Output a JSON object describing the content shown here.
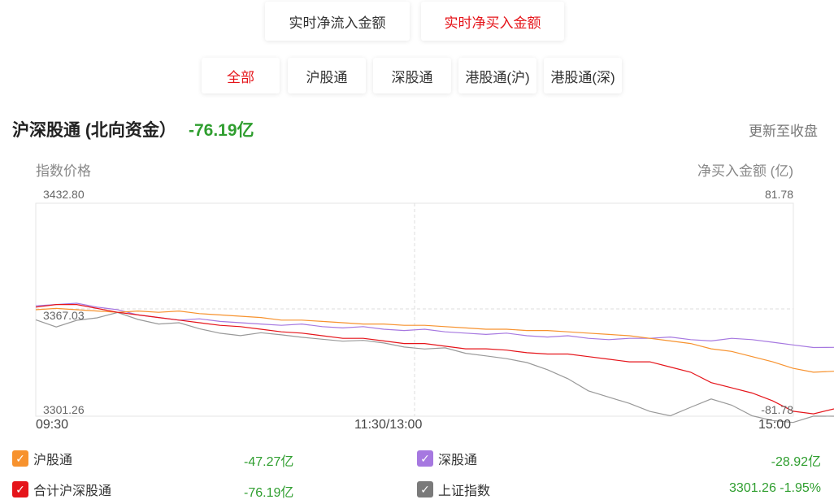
{
  "top_tabs": [
    {
      "label": "实时净流入金额",
      "active": false
    },
    {
      "label": "实时净买入金额",
      "active": true
    }
  ],
  "market_tabs": [
    {
      "label": "全部",
      "active": true
    },
    {
      "label": "沪股通",
      "active": false
    },
    {
      "label": "深股通",
      "active": false
    },
    {
      "label": "港股通(沪)",
      "active": false
    },
    {
      "label": "港股通(深)",
      "active": false
    }
  ],
  "header": {
    "title": "沪深股通 (北向资金）",
    "value": "-76.19亿",
    "update_link": "更新至收盘"
  },
  "chart_data": {
    "type": "line",
    "left_axis_title": "指数价格",
    "right_axis_title": "净买入金额 (亿)",
    "left_ticks": [
      "3432.80",
      "3367.03",
      "3301.26"
    ],
    "right_ticks": [
      "81.78",
      "-81.78"
    ],
    "x_ticks": [
      "09:30",
      "11:30/13:00",
      "15:00"
    ],
    "left_ylim": [
      3301.26,
      3432.8
    ],
    "right_ylim": [
      -81.78,
      81.78
    ],
    "grid": true,
    "series": [
      {
        "name": "沪股通",
        "color": "#f7922e",
        "axis": "right",
        "values": [
          0,
          1,
          0,
          -1,
          -2,
          -1,
          -2,
          -1,
          -3,
          -4,
          -5,
          -6,
          -8,
          -8,
          -9,
          -10,
          -11,
          -11,
          -12,
          -12,
          -13,
          -14,
          -15,
          -15,
          -16,
          -16,
          -17,
          -18,
          -19,
          -20,
          -22,
          -24,
          -26,
          -30,
          -32,
          -36,
          -40,
          -45,
          -48,
          -47.27
        ]
      },
      {
        "name": "深股通",
        "color": "#a678e0",
        "axis": "right",
        "values": [
          3,
          4,
          5,
          2,
          0,
          -4,
          -6,
          -8,
          -7,
          -9,
          -10,
          -11,
          -12,
          -11,
          -13,
          -14,
          -13,
          -15,
          -16,
          -15,
          -17,
          -18,
          -19,
          -18,
          -20,
          -21,
          -20,
          -22,
          -23,
          -22,
          -22,
          -21,
          -23,
          -24,
          -22,
          -23,
          -25,
          -27,
          -29,
          -28.92
        ]
      },
      {
        "name": "合计沪深股通",
        "color": "#e5141a",
        "axis": "right",
        "values": [
          2,
          4,
          4,
          1,
          -2,
          -4,
          -6,
          -8,
          -10,
          -12,
          -13,
          -15,
          -17,
          -18,
          -20,
          -22,
          -22,
          -24,
          -26,
          -26,
          -28,
          -30,
          -30,
          -31,
          -33,
          -34,
          -34,
          -36,
          -38,
          -40,
          -40,
          -44,
          -48,
          -56,
          -60,
          -64,
          -70,
          -78,
          -80,
          -76.19
        ]
      },
      {
        "name": "上证指数",
        "color": "#999999",
        "axis": "left",
        "values": [
          3360.8,
          3356.4,
          3360.5,
          3362.0,
          3365.3,
          3361.0,
          3358.2,
          3359.0,
          3355.3,
          3352.5,
          3351.0,
          3352.8,
          3351.5,
          3350.0,
          3348.8,
          3347.6,
          3348.1,
          3346.5,
          3344.0,
          3342.8,
          3343.5,
          3340.1,
          3338.5,
          3336.8,
          3334.4,
          3330.0,
          3324.4,
          3316.9,
          3313.0,
          3309.2,
          3304.2,
          3301.5,
          3306.8,
          3311.9,
          3308.1,
          3301.5,
          3298.6,
          3297.4,
          3301.3,
          3301.26
        ]
      }
    ]
  },
  "legend": [
    {
      "label": "沪股通",
      "value": "-47.27亿",
      "color": "#f7922e"
    },
    {
      "label": "深股通",
      "value": "-28.92亿",
      "color": "#a678e0"
    },
    {
      "label": "合计沪深股通",
      "value": "-76.19亿",
      "color": "#e5141a"
    },
    {
      "label": "上证指数",
      "value": "3301.26 -1.95%",
      "color": "#7a7a7a"
    }
  ]
}
